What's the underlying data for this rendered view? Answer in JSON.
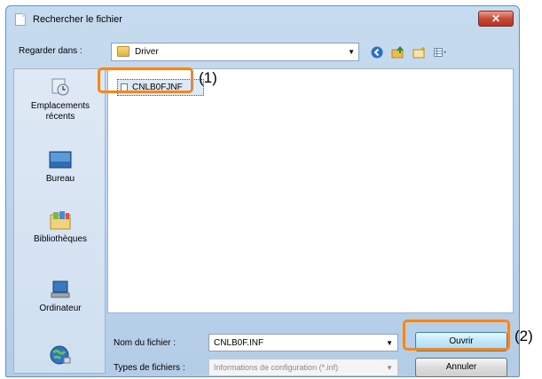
{
  "window": {
    "title": "Rechercher le fichier",
    "close_label": "✕"
  },
  "lookin": {
    "label": "Regarder dans :",
    "value": "Driver"
  },
  "toolbar": {
    "icons": [
      "back-icon",
      "up-folder-icon",
      "new-folder-icon",
      "view-menu-icon"
    ]
  },
  "places": [
    {
      "id": "recent",
      "icon": "recent-places-icon",
      "label_line1": "Emplacements",
      "label_line2": "récents"
    },
    {
      "id": "desktop",
      "icon": "desktop-icon",
      "label_line1": "Bureau",
      "label_line2": ""
    },
    {
      "id": "libraries",
      "icon": "libraries-icon",
      "label_line1": "Bibliothèques",
      "label_line2": ""
    },
    {
      "id": "computer",
      "icon": "computer-icon",
      "label_line1": "Ordinateur",
      "label_line2": ""
    },
    {
      "id": "network",
      "icon": "network-globe-icon",
      "label_line1": "",
      "label_line2": ""
    }
  ],
  "files": [
    {
      "name": "CNLB0FJNF"
    }
  ],
  "callouts": {
    "file": "(1)",
    "open": "(2)"
  },
  "filename": {
    "label": "Nom du fichier :",
    "value": "CNLB0F.INF"
  },
  "filetype": {
    "label": "Types de fichiers :",
    "value": "Informations de configuration (*.inf)"
  },
  "buttons": {
    "open": "Ouvrir",
    "cancel": "Annuler"
  },
  "colors": {
    "highlight": "#e8892f",
    "title_bar": "#b4cde7",
    "close_button": "#c74a36"
  }
}
